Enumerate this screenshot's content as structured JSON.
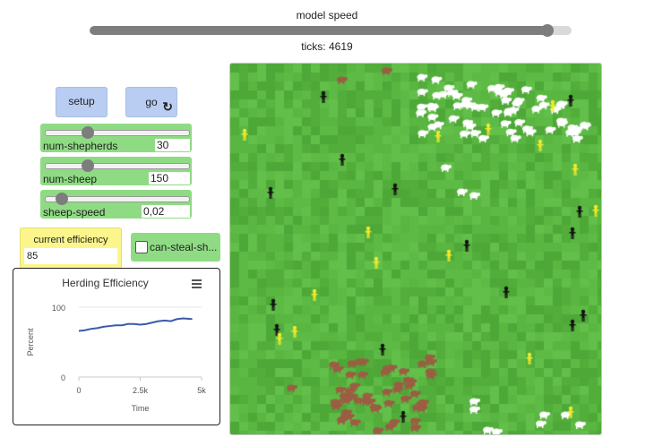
{
  "speed": {
    "label": "model speed",
    "value": 0.95
  },
  "ticks": {
    "label": "ticks:",
    "value": "4619"
  },
  "buttons": {
    "setup": "setup",
    "go": "go",
    "go_icon": "forever-icon"
  },
  "sliders": [
    {
      "id": "num-shepherds",
      "label": "num-shepherds",
      "value": "30",
      "fraction": 0.3
    },
    {
      "id": "num-sheep",
      "label": "num-sheep",
      "value": "150",
      "fraction": 0.3
    },
    {
      "id": "sheep-speed",
      "label": "sheep-speed",
      "value": "0,02",
      "fraction": 0.12
    }
  ],
  "monitor": {
    "label": "current efficiency",
    "value": "85"
  },
  "switch": {
    "label": "can-steal-sh...",
    "on": false
  },
  "plot": {
    "title": "Herding Efficiency",
    "xlabel": "Time",
    "ylabel": "Percent",
    "y_ticks": [
      "100",
      "0"
    ],
    "x_ticks": [
      "0",
      "2.5k",
      "5k"
    ],
    "line_color": "#3a5ba8"
  },
  "chart_data": {
    "type": "line",
    "title": "Herding Efficiency",
    "xlabel": "Time",
    "ylabel": "Percent",
    "xlim": [
      0,
      5000
    ],
    "ylim": [
      0,
      100
    ],
    "series": [
      {
        "x": [
          0,
          250,
          500,
          750,
          1000,
          1250,
          1500,
          1750,
          2000,
          2250,
          2500,
          2750,
          3000,
          3250,
          3500,
          3750,
          4000,
          4250,
          4619
        ],
        "y": [
          66,
          67,
          69,
          70,
          72,
          73,
          74,
          74,
          76,
          76,
          75,
          76,
          78,
          80,
          81,
          80,
          83,
          84,
          83
        ]
      }
    ]
  },
  "world": {
    "colors": {
      "grass": [
        "#59b640",
        "#52ad3b",
        "#5dbb45",
        "#4ea838",
        "#62bf4a"
      ],
      "sheep": "#ffffff",
      "herded_sheep": "#9b5e43",
      "shepherd": "#111111",
      "carrying_shepherd": "#f2ea2b"
    }
  }
}
